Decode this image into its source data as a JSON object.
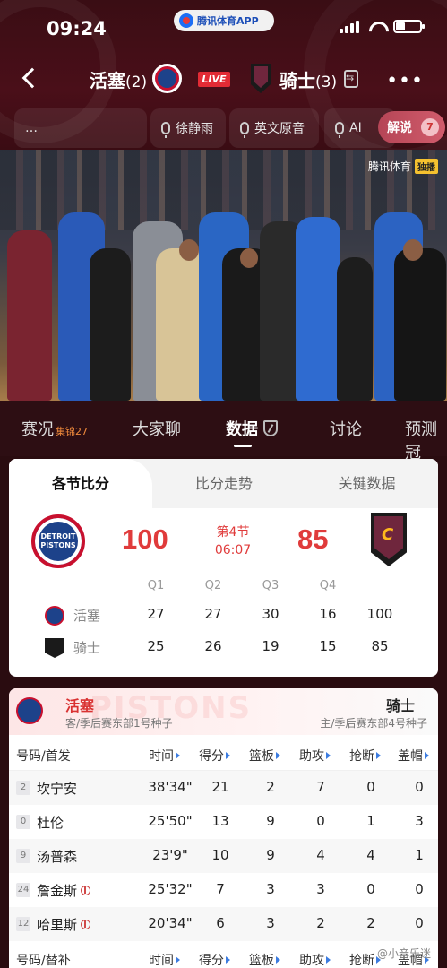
{
  "status_bar": {
    "time": "09:24",
    "app_name": "腾讯体育APP"
  },
  "match_header": {
    "home_team": "活塞",
    "home_series": "(2)",
    "away_team": "骑士",
    "away_series": "(3)",
    "live_label": "LIVE"
  },
  "commentary": {
    "channels": [
      "…",
      "徐静雨",
      "英文原音",
      "AI"
    ],
    "jieshuo_label": "解说",
    "jieshuo_count": "7"
  },
  "video": {
    "watermark": "腾讯体育",
    "badge": "独播"
  },
  "tabs": [
    {
      "label": "赛况",
      "sub": "集锦27"
    },
    {
      "label": "大家聊"
    },
    {
      "label": "数据"
    },
    {
      "label": "讨论"
    },
    {
      "label": "预测冠"
    }
  ],
  "quarter_card": {
    "tabs": [
      "各节比分",
      "比分走势",
      "关键数据"
    ],
    "home_score": "100",
    "away_score": "85",
    "period": "第4节",
    "clock": "06:07",
    "headers": [
      "Q1",
      "Q2",
      "Q3",
      "Q4"
    ],
    "rows": [
      {
        "team": "活塞",
        "q": [
          "27",
          "27",
          "30",
          "16"
        ],
        "total": "100"
      },
      {
        "team": "骑士",
        "q": [
          "25",
          "26",
          "19",
          "15"
        ],
        "total": "85"
      }
    ]
  },
  "player_card": {
    "home_team": "活塞",
    "home_sub": "客/季后赛东部1号种子",
    "away_team": "骑士",
    "away_sub": "主/季后赛东部4号种子",
    "watermark": "PISTONS",
    "columns": [
      "号码/首发",
      "时间",
      "得分",
      "篮板",
      "助攻",
      "抢断",
      "盖帽"
    ],
    "starters": [
      {
        "num": "2",
        "name": "坎宁安",
        "time": "38'34\"",
        "pts": "21",
        "reb": "2",
        "ast": "7",
        "stl": "0",
        "blk": "0",
        "badge": false
      },
      {
        "num": "0",
        "name": "杜伦",
        "time": "25'50\"",
        "pts": "13",
        "reb": "9",
        "ast": "0",
        "stl": "1",
        "blk": "3",
        "badge": false
      },
      {
        "num": "9",
        "name": "汤普森",
        "time": "23'9\"",
        "pts": "10",
        "reb": "9",
        "ast": "4",
        "stl": "4",
        "blk": "1",
        "badge": false
      },
      {
        "num": "24",
        "name": "詹金斯",
        "time": "25'32\"",
        "pts": "7",
        "reb": "3",
        "ast": "3",
        "stl": "0",
        "blk": "0",
        "badge": true
      },
      {
        "num": "12",
        "name": "哈里斯",
        "time": "20'34\"",
        "pts": "6",
        "reb": "3",
        "ast": "2",
        "stl": "2",
        "blk": "0",
        "badge": true
      }
    ],
    "bench_columns": [
      "号码/替补",
      "时间",
      "得分",
      "篮板",
      "助攻",
      "抢断",
      "盖帽"
    ],
    "footer_watermark": "@小音乐迷"
  }
}
